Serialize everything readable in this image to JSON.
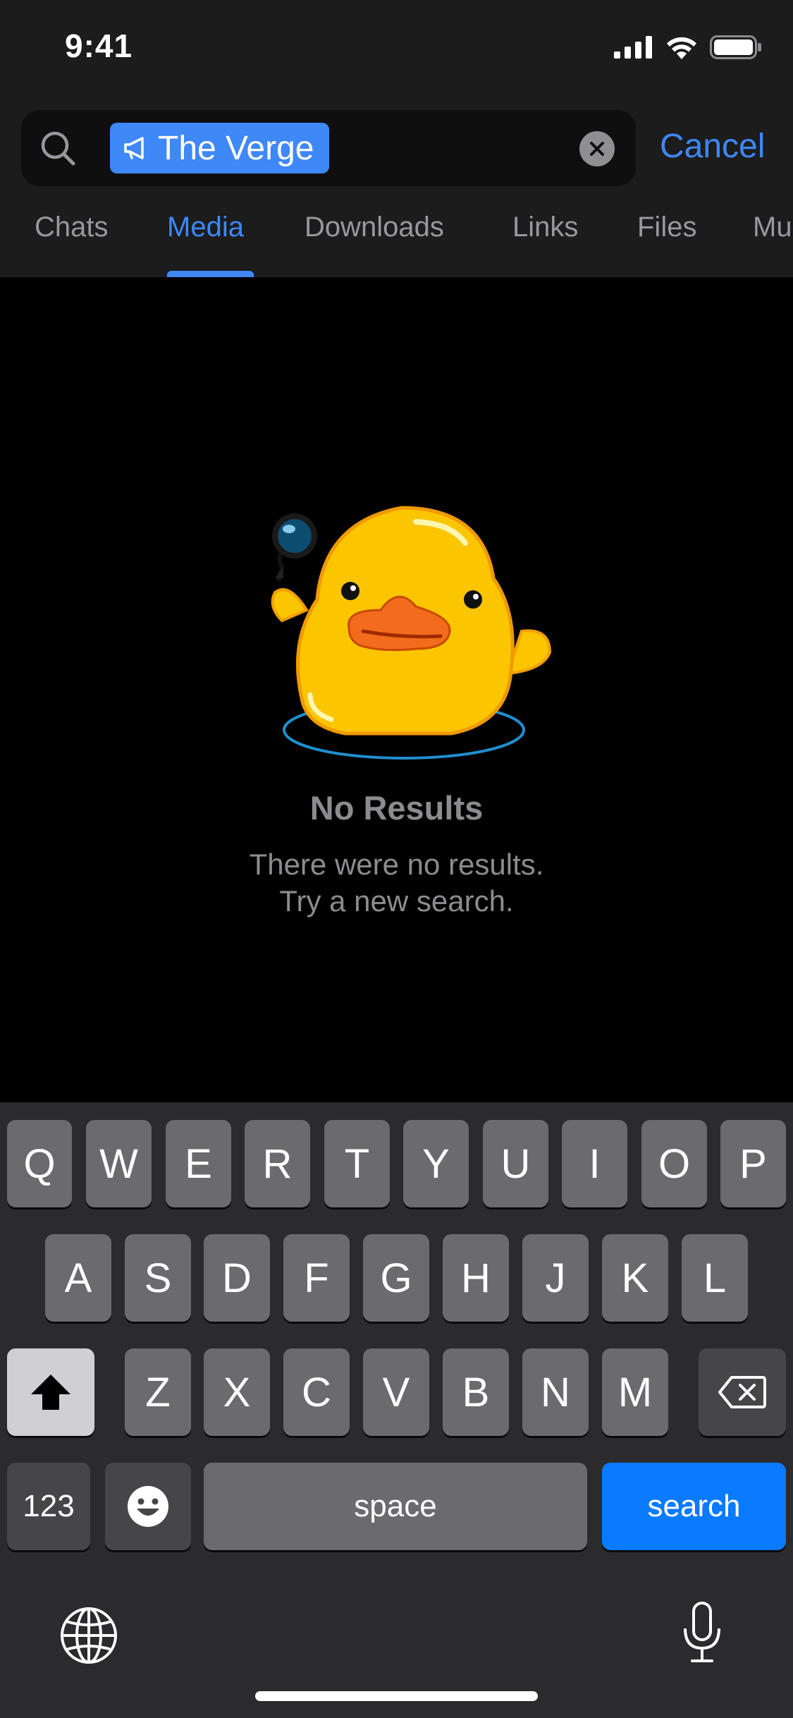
{
  "status_bar": {
    "time": "9:41"
  },
  "search": {
    "token_label": "The Verge",
    "cancel_label": "Cancel"
  },
  "tabs": [
    {
      "label": "Chats",
      "active": false
    },
    {
      "label": "Media",
      "active": true
    },
    {
      "label": "Downloads",
      "active": false
    },
    {
      "label": "Links",
      "active": false
    },
    {
      "label": "Files",
      "active": false
    },
    {
      "label": "Mu",
      "active": false
    }
  ],
  "empty_state": {
    "title": "No Results",
    "subtitle_line1": "There were no results.",
    "subtitle_line2": "Try a new search.",
    "illustration": "duck-with-magnifier"
  },
  "keyboard": {
    "row1": [
      "Q",
      "W",
      "E",
      "R",
      "T",
      "Y",
      "U",
      "I",
      "O",
      "P"
    ],
    "row2": [
      "A",
      "S",
      "D",
      "F",
      "G",
      "H",
      "J",
      "K",
      "L"
    ],
    "row3": [
      "Z",
      "X",
      "C",
      "V",
      "B",
      "N",
      "M"
    ],
    "numbers_label": "123",
    "space_label": "space",
    "search_label": "search",
    "icons": [
      "shift-icon",
      "backspace-icon",
      "emoji-icon",
      "globe-icon",
      "microphone-icon"
    ]
  },
  "colors": {
    "accent": "#3e88f7",
    "search_key": "#0a7aff",
    "background": "#000000",
    "header": "#1c1c1d",
    "keyboard": "#2b2b2d"
  }
}
